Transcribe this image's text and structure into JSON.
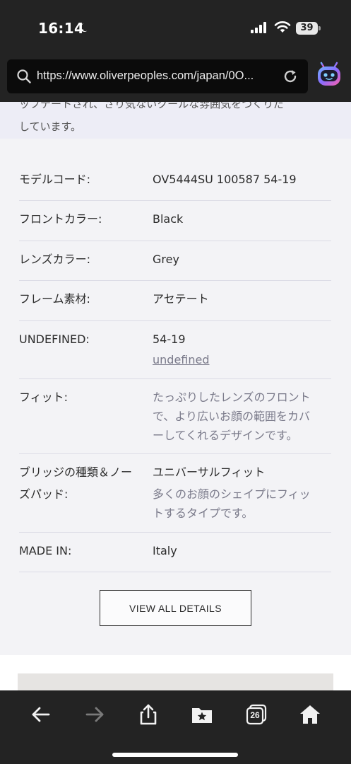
{
  "status_bar": {
    "time": "16:14",
    "battery_level": "39",
    "icons": [
      "moon-icon",
      "signal-icon",
      "wifi-icon",
      "battery-icon"
    ]
  },
  "browser": {
    "url": "https://www.oliverpeoples.com/japan/0O...",
    "icons": [
      "search-icon",
      "reload-icon",
      "bot-icon"
    ]
  },
  "description": {
    "line1": "ッフテートされ、さり気ないクールな雰囲気をつくりだ",
    "line2": "しています。"
  },
  "specs": [
    {
      "label": "モデルコード:",
      "value": "OV5444SU 100587 54-19"
    },
    {
      "label": "フロントカラー:",
      "value": "Black"
    },
    {
      "label": "レンズカラー:",
      "value": "Grey"
    },
    {
      "label": "フレーム素材:",
      "value": "アセテート"
    },
    {
      "label": "UNDEFINED:",
      "value": "54-19",
      "link": "undefined"
    },
    {
      "label": "フィット:",
      "value_lines": [
        "たっぷりしたレンズのフロント",
        "で、より広いお顔の範囲をカバ",
        "ーしてくれるデザインです。"
      ]
    },
    {
      "label_lines": [
        "ブリッジの種類＆ノー",
        "ズパッド:"
      ],
      "value": "ユニバーサルフィット",
      "sub_lines": [
        "多くのお顔のシェイプにフィッ",
        "トするタイプです。"
      ]
    },
    {
      "label": "MADE IN:",
      "value": "Italy"
    }
  ],
  "details_button": "VIEW ALL DETAILS",
  "toolbar": {
    "tabs_count": "26",
    "icons": [
      "back-arrow-icon",
      "forward-arrow-icon",
      "share-icon",
      "bookmarks-folder-icon",
      "tabs-icon",
      "home-icon"
    ]
  }
}
